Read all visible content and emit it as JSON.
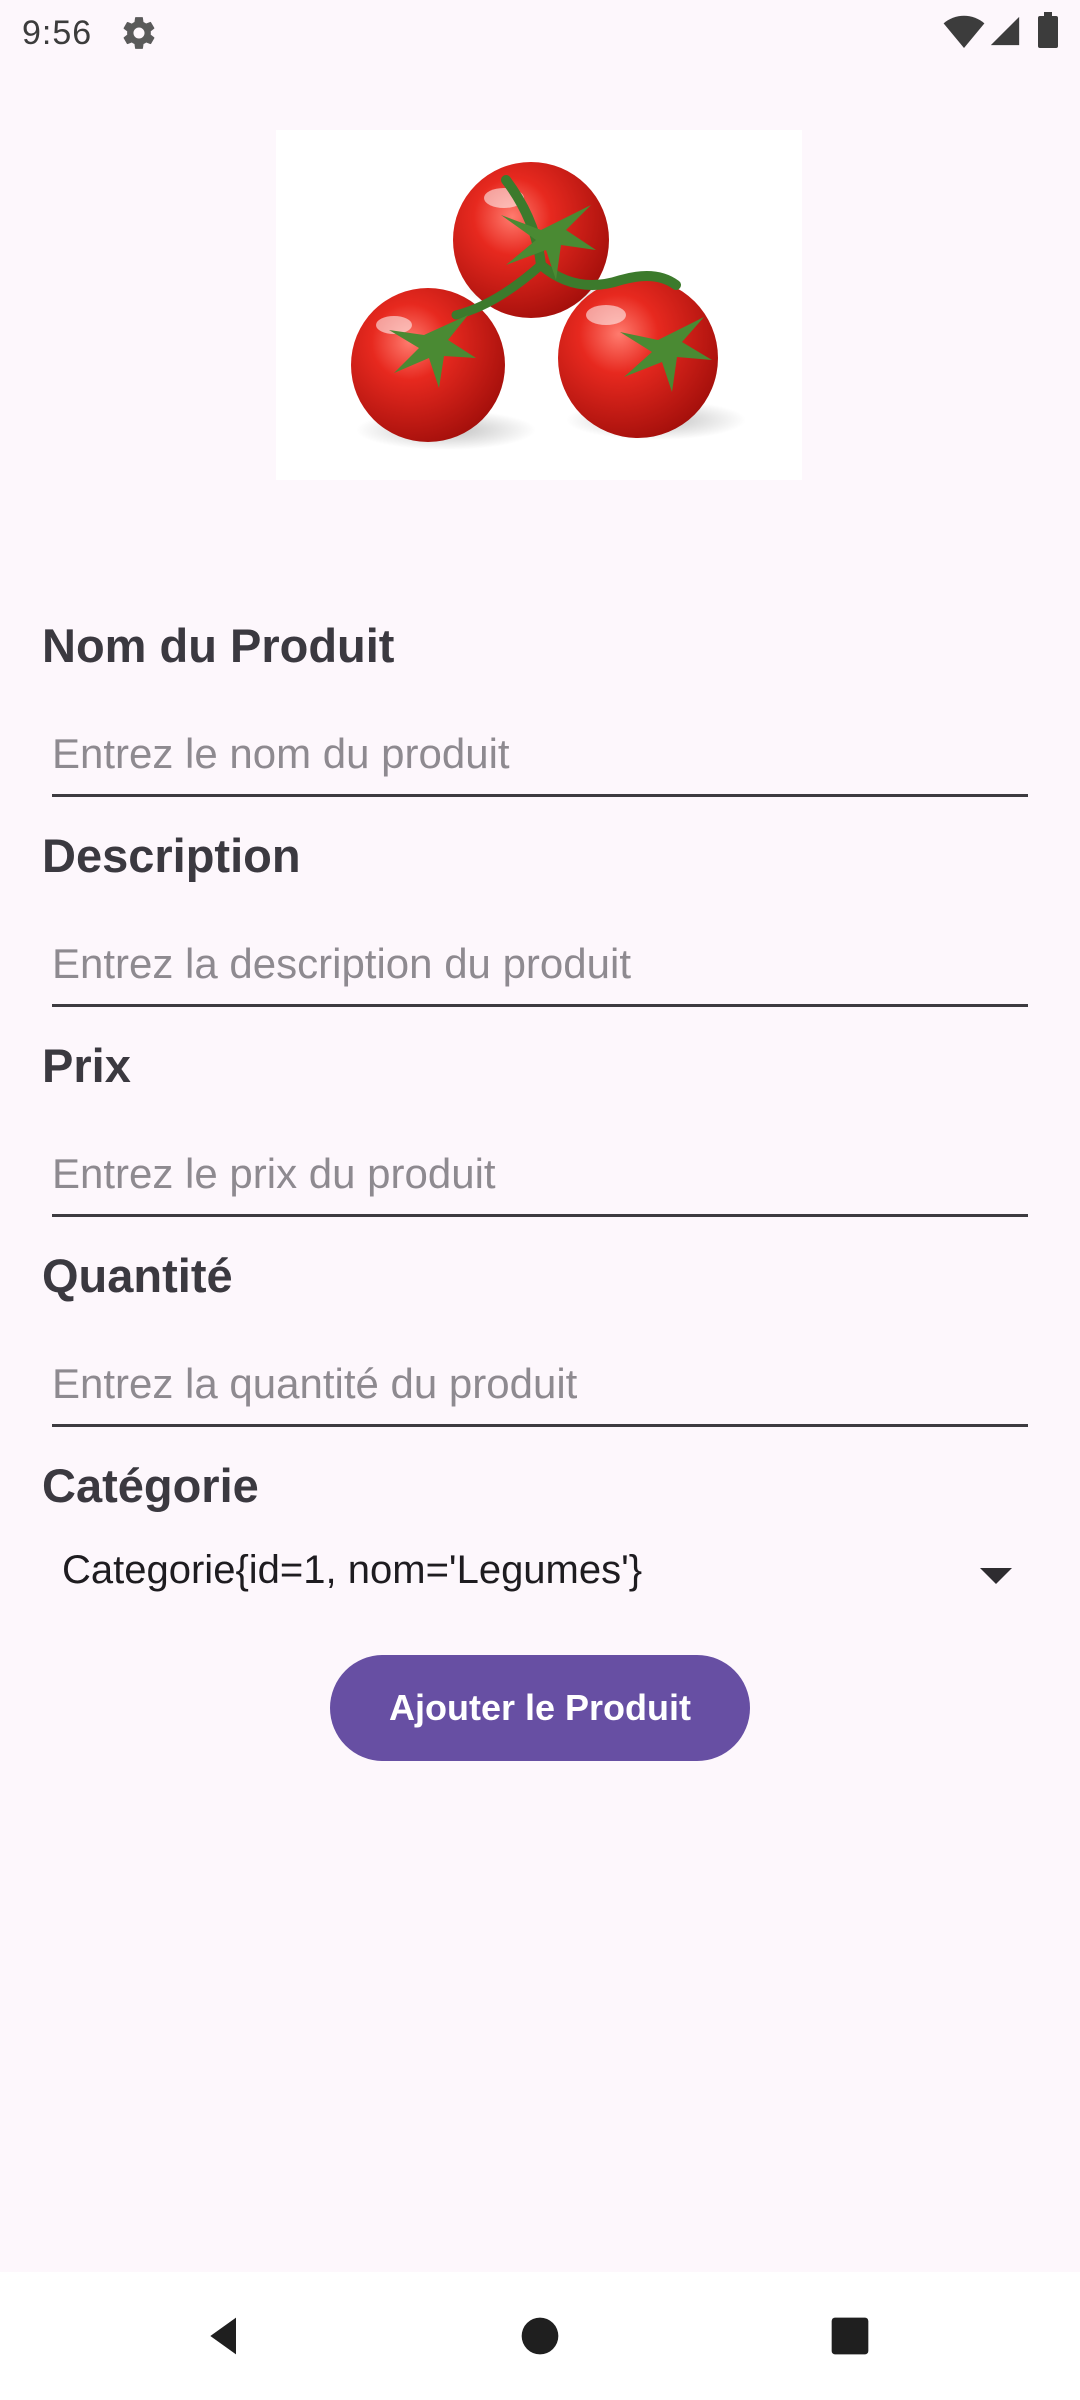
{
  "status_bar": {
    "time": "9:56",
    "icons": [
      "gear-icon",
      "wifi-icon",
      "signal-icon",
      "battery-icon"
    ]
  },
  "product_image": {
    "icon": "tomatoes-image"
  },
  "form": {
    "name_label": "Nom du Produit",
    "name_placeholder": "Entrez le nom du produit",
    "name_value": "",
    "description_label": "Description",
    "description_placeholder": "Entrez la description du produit",
    "description_value": "",
    "price_label": "Prix",
    "price_placeholder": "Entrez le prix du produit",
    "price_value": "",
    "quantity_label": "Quantité",
    "quantity_placeholder": "Entrez la quantité du produit",
    "quantity_value": "",
    "category_label": "Catégorie",
    "category_selected": "Categorie{id=1, nom='Legumes'}"
  },
  "actions": {
    "add_button_label": "Ajouter le Produit"
  },
  "navigation": {
    "icons": [
      "back-icon",
      "home-icon",
      "recents-icon"
    ]
  },
  "colors": {
    "background": "#fdf7fc",
    "accent": "#674fa3",
    "label_text": "#3b3940",
    "placeholder_text": "#8e8a90",
    "tomato_red": "#e0231b"
  }
}
